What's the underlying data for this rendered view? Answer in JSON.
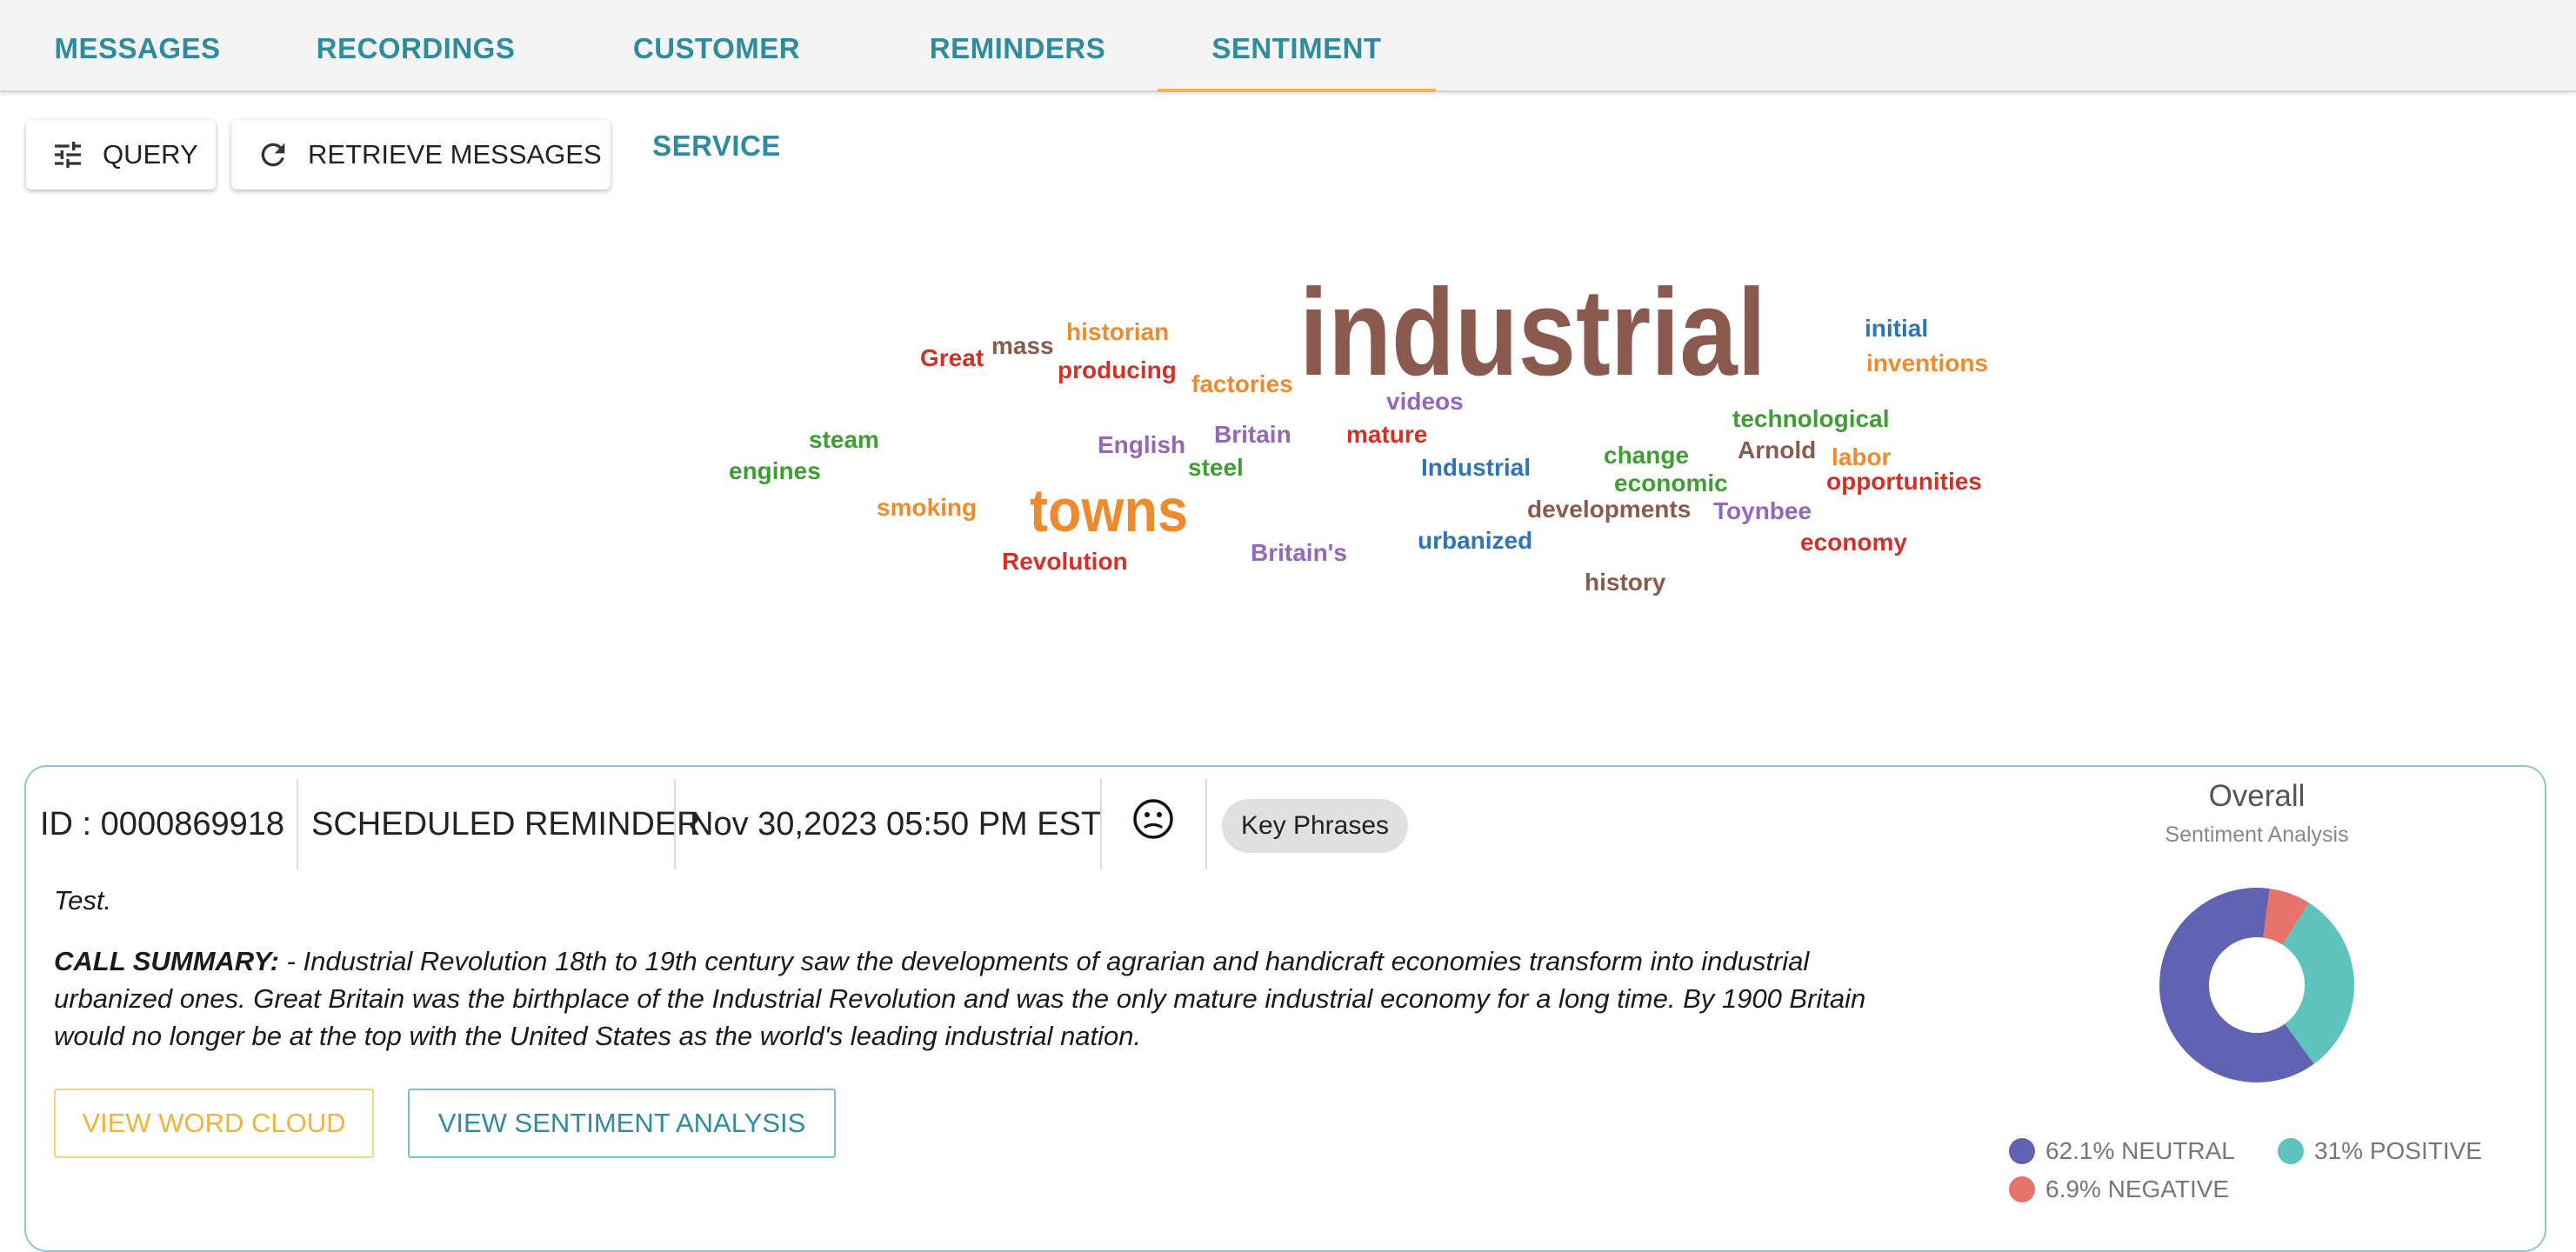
{
  "tabs": [
    {
      "label": "MESSAGES"
    },
    {
      "label": "RECORDINGS"
    },
    {
      "label": "CUSTOMER SERVICE"
    },
    {
      "label": "REMINDERS"
    },
    {
      "label": "SENTIMENT",
      "active": true
    }
  ],
  "toolbar": {
    "query_label": "QUERY",
    "retrieve_label": "RETRIEVE MESSAGES",
    "query_icon": "tune-sliders-icon",
    "retrieve_icon": "refresh-icon"
  },
  "word_cloud": [
    {
      "text": "industrial",
      "color": "#8b5a4f"
    },
    {
      "text": "towns",
      "color": "#f08a2e"
    },
    {
      "text": "historian",
      "color": "#f08a2e"
    },
    {
      "text": "Great",
      "color": "#d2312a"
    },
    {
      "text": "mass",
      "color": "#8b5a4f"
    },
    {
      "text": "producing",
      "color": "#d2312a"
    },
    {
      "text": "factories",
      "color": "#f08a2e"
    },
    {
      "text": "videos",
      "color": "#9467bd"
    },
    {
      "text": "initial",
      "color": "#2f74b5"
    },
    {
      "text": "inventions",
      "color": "#f08a2e"
    },
    {
      "text": "steam",
      "color": "#3f9d34"
    },
    {
      "text": "engines",
      "color": "#3f9d34"
    },
    {
      "text": "English",
      "color": "#9467bd"
    },
    {
      "text": "Britain",
      "color": "#9467bd"
    },
    {
      "text": "mature",
      "color": "#d2312a"
    },
    {
      "text": "technological",
      "color": "#3f9d34"
    },
    {
      "text": "change",
      "color": "#3f9d34"
    },
    {
      "text": "Arnold",
      "color": "#8b5a4f"
    },
    {
      "text": "labor",
      "color": "#f08a2e"
    },
    {
      "text": "steel",
      "color": "#3f9d34"
    },
    {
      "text": "Industrial",
      "color": "#2f74b5"
    },
    {
      "text": "economic",
      "color": "#3f9d34"
    },
    {
      "text": "opportunities",
      "color": "#d2312a"
    },
    {
      "text": "smoking",
      "color": "#f08a2e"
    },
    {
      "text": "developments",
      "color": "#8b5a4f"
    },
    {
      "text": "Toynbee",
      "color": "#9467bd"
    },
    {
      "text": "urbanized",
      "color": "#2f74b5"
    },
    {
      "text": "economy",
      "color": "#d2312a"
    },
    {
      "text": "Britain's",
      "color": "#9467bd"
    },
    {
      "text": "Revolution",
      "color": "#d2312a"
    },
    {
      "text": "history",
      "color": "#8b5a4f"
    }
  ],
  "message": {
    "id_text": "ID : 0000869918",
    "type": "SCHEDULED REMINDER",
    "datetime": "Nov 30,2023 05:50 PM EST",
    "sentiment_icon": "neutral-face-icon",
    "key_phrases_label": "Key Phrases",
    "text": "Test.",
    "summary_label": "CALL SUMMARY:",
    "summary": " - Industrial Revolution 18th to 19th century saw the developments of agrarian and handicraft economies transform into industrial urbanized ones. Great Britain was the birthplace of the Industrial Revolution and was the only mature industrial economy for a long time. By 1900 Britain would no longer be at the top with the United States as the world's leading industrial nation.",
    "view_word_cloud_label": "VIEW WORD CLOUD",
    "view_sentiment_label": "VIEW SENTIMENT ANALYSIS"
  },
  "overall": {
    "title": "Overall",
    "subtitle": "Sentiment Analysis",
    "legend": [
      {
        "label": "62.1% NEUTRAL",
        "color": "#6063b4"
      },
      {
        "label": "31% POSITIVE",
        "color": "#5fc3bd"
      },
      {
        "label": "6.9% NEGATIVE",
        "color": "#e5736c"
      }
    ]
  },
  "chart_data": {
    "type": "pie",
    "title": "Overall",
    "subtitle": "Sentiment Analysis",
    "categories": [
      "NEUTRAL",
      "POSITIVE",
      "NEGATIVE"
    ],
    "values": [
      62.1,
      31,
      6.9
    ],
    "colors": [
      "#6063b4",
      "#5fc3bd",
      "#e5736c"
    ],
    "legend": "bottom"
  },
  "colors": {
    "tab_text": "#2f8b9e",
    "tab_active_indicator": "#f0b25a",
    "card_border": "#8fc6d3",
    "word_cloud_button": "#f2b33d",
    "sentiment_button": "#2f8b9e"
  }
}
